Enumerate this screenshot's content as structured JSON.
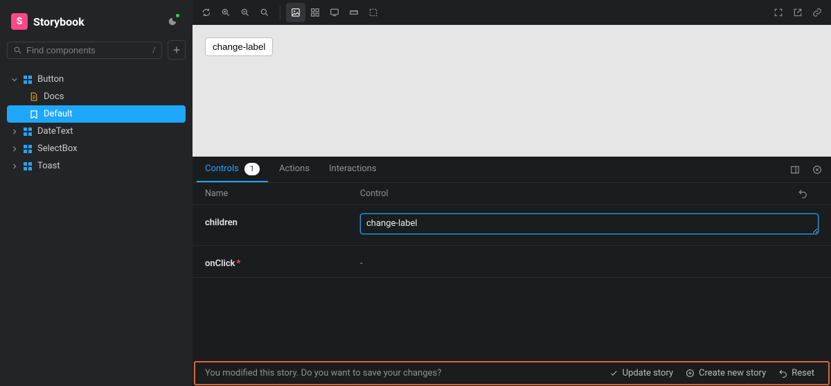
{
  "brand": {
    "logo_letter": "S",
    "name": "Storybook"
  },
  "search": {
    "placeholder": "Find components",
    "shortcut": "/"
  },
  "tree": {
    "items": [
      {
        "label": "Button",
        "expanded": true
      },
      {
        "label": "DateText",
        "expanded": false
      },
      {
        "label": "SelectBox",
        "expanded": false
      },
      {
        "label": "Toast",
        "expanded": false
      }
    ],
    "button_children": [
      {
        "label": "Docs",
        "kind": "docs"
      },
      {
        "label": "Default",
        "kind": "story",
        "selected": true
      }
    ]
  },
  "canvas": {
    "button_label": "change-label"
  },
  "addon": {
    "tabs": {
      "controls": "Controls",
      "controls_badge": "1",
      "actions": "Actions",
      "interactions": "Interactions"
    },
    "header": {
      "name": "Name",
      "control": "Control"
    },
    "rows": {
      "children": {
        "name": "children",
        "value": "change-label"
      },
      "onClick": {
        "name": "onClick",
        "dash": "-"
      }
    }
  },
  "savebar": {
    "message": "You modified this story. Do you want to save your changes?",
    "update": "Update story",
    "create": "Create new story",
    "reset": "Reset"
  }
}
